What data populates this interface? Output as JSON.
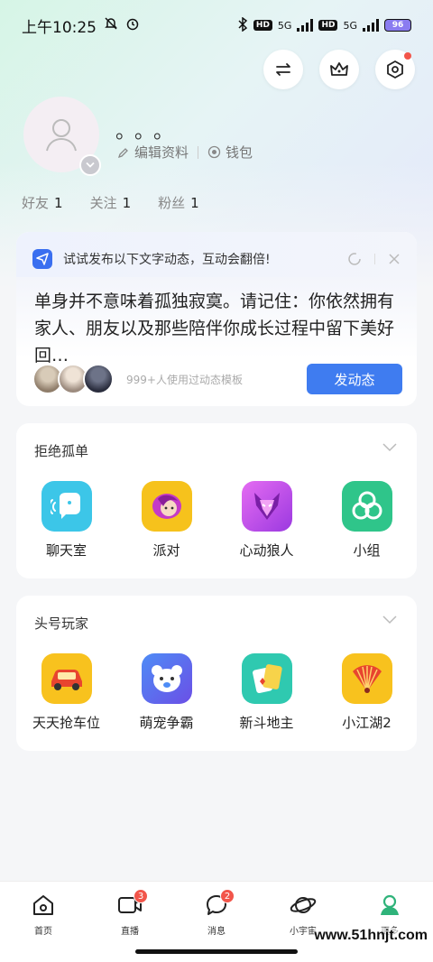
{
  "status_bar": {
    "time": "上午10:25",
    "battery": "96",
    "net_a": "5G",
    "net_b": "5G",
    "hd": "HD"
  },
  "profile": {
    "nickname": "。。。",
    "edit_label": "编辑资料",
    "wallet_label": "钱包",
    "stats": [
      {
        "label": "好友",
        "value": "1"
      },
      {
        "label": "关注",
        "value": "1"
      },
      {
        "label": "粉丝",
        "value": "1"
      }
    ]
  },
  "post_card": {
    "tip": "试试发布以下文字动态，互动会翻倍!",
    "content": "单身并不意味着孤独寂寞。请记住：你依然拥有家人、朋友以及那些陪伴你成长过程中留下美好回…",
    "usage": "999+人使用过动态模板",
    "button": "发动态"
  },
  "section1": {
    "title": "拒绝孤单",
    "apps": [
      {
        "label": "聊天室",
        "icon": "chat-room-icon",
        "color": "#3cc6e8"
      },
      {
        "label": "派对",
        "icon": "party-icon",
        "color": "#f6c21c"
      },
      {
        "label": "心动狼人",
        "icon": "werewolf-icon",
        "color": "#c04fe8"
      },
      {
        "label": "小组",
        "icon": "group-icon",
        "color": "#2fc58a"
      }
    ]
  },
  "section2": {
    "title": "头号玩家",
    "apps": [
      {
        "label": "天天抢车位",
        "icon": "car-icon",
        "color": "#f8c21e"
      },
      {
        "label": "萌宠争霸",
        "icon": "pet-bear-icon",
        "color": "#5a6cf2"
      },
      {
        "label": "新斗地主",
        "icon": "cards-icon",
        "color": "#2fc9b0"
      },
      {
        "label": "小江湖2",
        "icon": "fan-icon",
        "color": "#f8c21e"
      }
    ]
  },
  "tabbar": {
    "items": [
      {
        "label": "首页",
        "icon": "home-icon"
      },
      {
        "label": "直播",
        "icon": "video-icon",
        "badge": "3"
      },
      {
        "label": "消息",
        "icon": "message-icon",
        "badge": "2"
      },
      {
        "label": "小宇宙",
        "icon": "planet-icon"
      },
      {
        "label": "更多",
        "icon": "profile-icon"
      }
    ]
  },
  "watermark": "www.51hnjt.com",
  "colors": {
    "accent": "#3f7cf0",
    "badge": "#f2554a",
    "active_tab": "#2fb37a"
  }
}
